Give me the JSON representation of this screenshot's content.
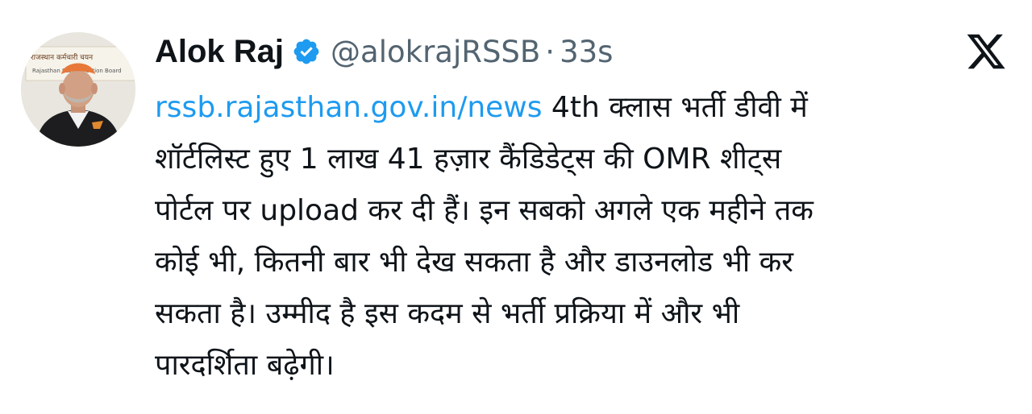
{
  "tweet": {
    "author_name": "Alok Raj",
    "handle": "@alokrajRSSB",
    "separator": "·",
    "time": "33s",
    "link": "rssb.rajasthan.gov.in/news",
    "lines": [
      " 4th क्लास भर्ती डीवी में",
      "शॉर्टलिस्ट हुए 1 लाख 41 हज़ार कैंडिडेट्स की OMR शीट्स",
      "पोर्टल पर upload कर दी हैं। इन सबको अगले एक महीने तक",
      "कोई भी, कितनी बार भी देख सकता है और डाउनलोड भी कर",
      "सकता है। उम्मीद है इस कदम से भर्ती प्रक्रिया में और भी",
      "पारदर्शिता बढ़ेगी।"
    ],
    "avatar_banner_text": [
      "राजस्थान कर्मचारी चयन",
      "Rajasthan Staff Selection Board"
    ]
  },
  "icons": {
    "verified": "verified-badge-icon",
    "platform": "x-logo-icon"
  },
  "colors": {
    "link": "#1d9bf0",
    "secondary_text": "#536471",
    "verified": "#1d9bf0",
    "text": "#0f1419"
  }
}
